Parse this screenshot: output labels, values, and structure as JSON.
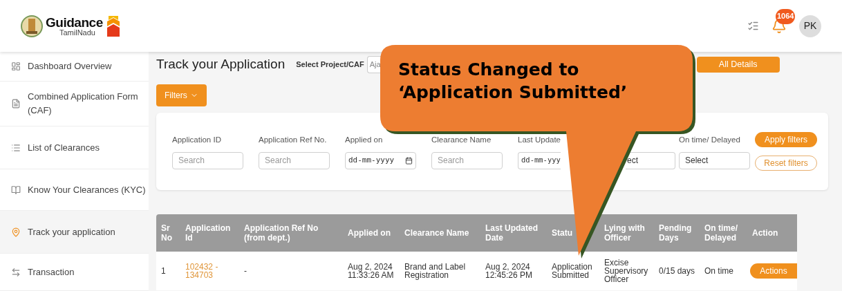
{
  "header": {
    "logo_title": "Guidance",
    "logo_subtitle": "TamilNadu",
    "notification_count": "1064",
    "avatar_initials": "PK"
  },
  "sidebar": {
    "items": [
      {
        "label": "Dashboard Overview",
        "selected": false
      },
      {
        "label": "Combined Application Form (CAF)",
        "selected": false
      },
      {
        "label": "List of Clearances",
        "selected": false
      },
      {
        "label": "Know Your Clearances (KYC)",
        "selected": false
      },
      {
        "label": "Track your application",
        "selected": true
      },
      {
        "label": "Transaction",
        "selected": false
      }
    ]
  },
  "page": {
    "title": "Track your Application",
    "project_label": "Select Project/CAF",
    "project_value": "Aja",
    "all_details_button": "All Details",
    "filters_button": "Filters"
  },
  "filters": {
    "fields": [
      {
        "kind": "text",
        "label": "Application ID",
        "placeholder": "Search"
      },
      {
        "kind": "text",
        "label": "Application Ref No.",
        "placeholder": "Search"
      },
      {
        "kind": "date",
        "label": "Applied on",
        "value": "dd-mm-yyyy"
      },
      {
        "kind": "text",
        "label": "Clearance Name",
        "placeholder": "Search"
      },
      {
        "kind": "date",
        "label": "Last Update",
        "value": "dd-mm-yyy"
      },
      {
        "kind": "select",
        "value": "ect"
      },
      {
        "kind": "select",
        "label": "On time/ Delayed",
        "value": "Select"
      }
    ],
    "apply_button": "Apply filters",
    "reset_button": "Reset filters"
  },
  "table": {
    "columns": [
      "Sr No",
      "Application Id",
      "Application Ref No (from dept.)",
      "Applied on",
      "Clearance Name",
      "Last Updated Date",
      "Statu",
      "Lying with Officer",
      "Pending Days",
      "On time/ Delayed",
      "Action"
    ],
    "rows": [
      {
        "sr_no": "1",
        "application_id": "102432 - 134703",
        "ref_no": "-",
        "applied_on": "Aug 2, 2024 11:33:26 AM",
        "clearance_name": "Brand and Label Registration",
        "last_updated": "Aug 2, 2024 12:45:26 PM",
        "status": "Application Submitted",
        "lying_with": "Excise Supervisory Officer",
        "pending_days": "0/15 days",
        "on_time": "On time",
        "action": "Actions"
      }
    ]
  },
  "callout": {
    "lines": [
      "Status Changed to",
      "‘Application Submitted’"
    ]
  }
}
